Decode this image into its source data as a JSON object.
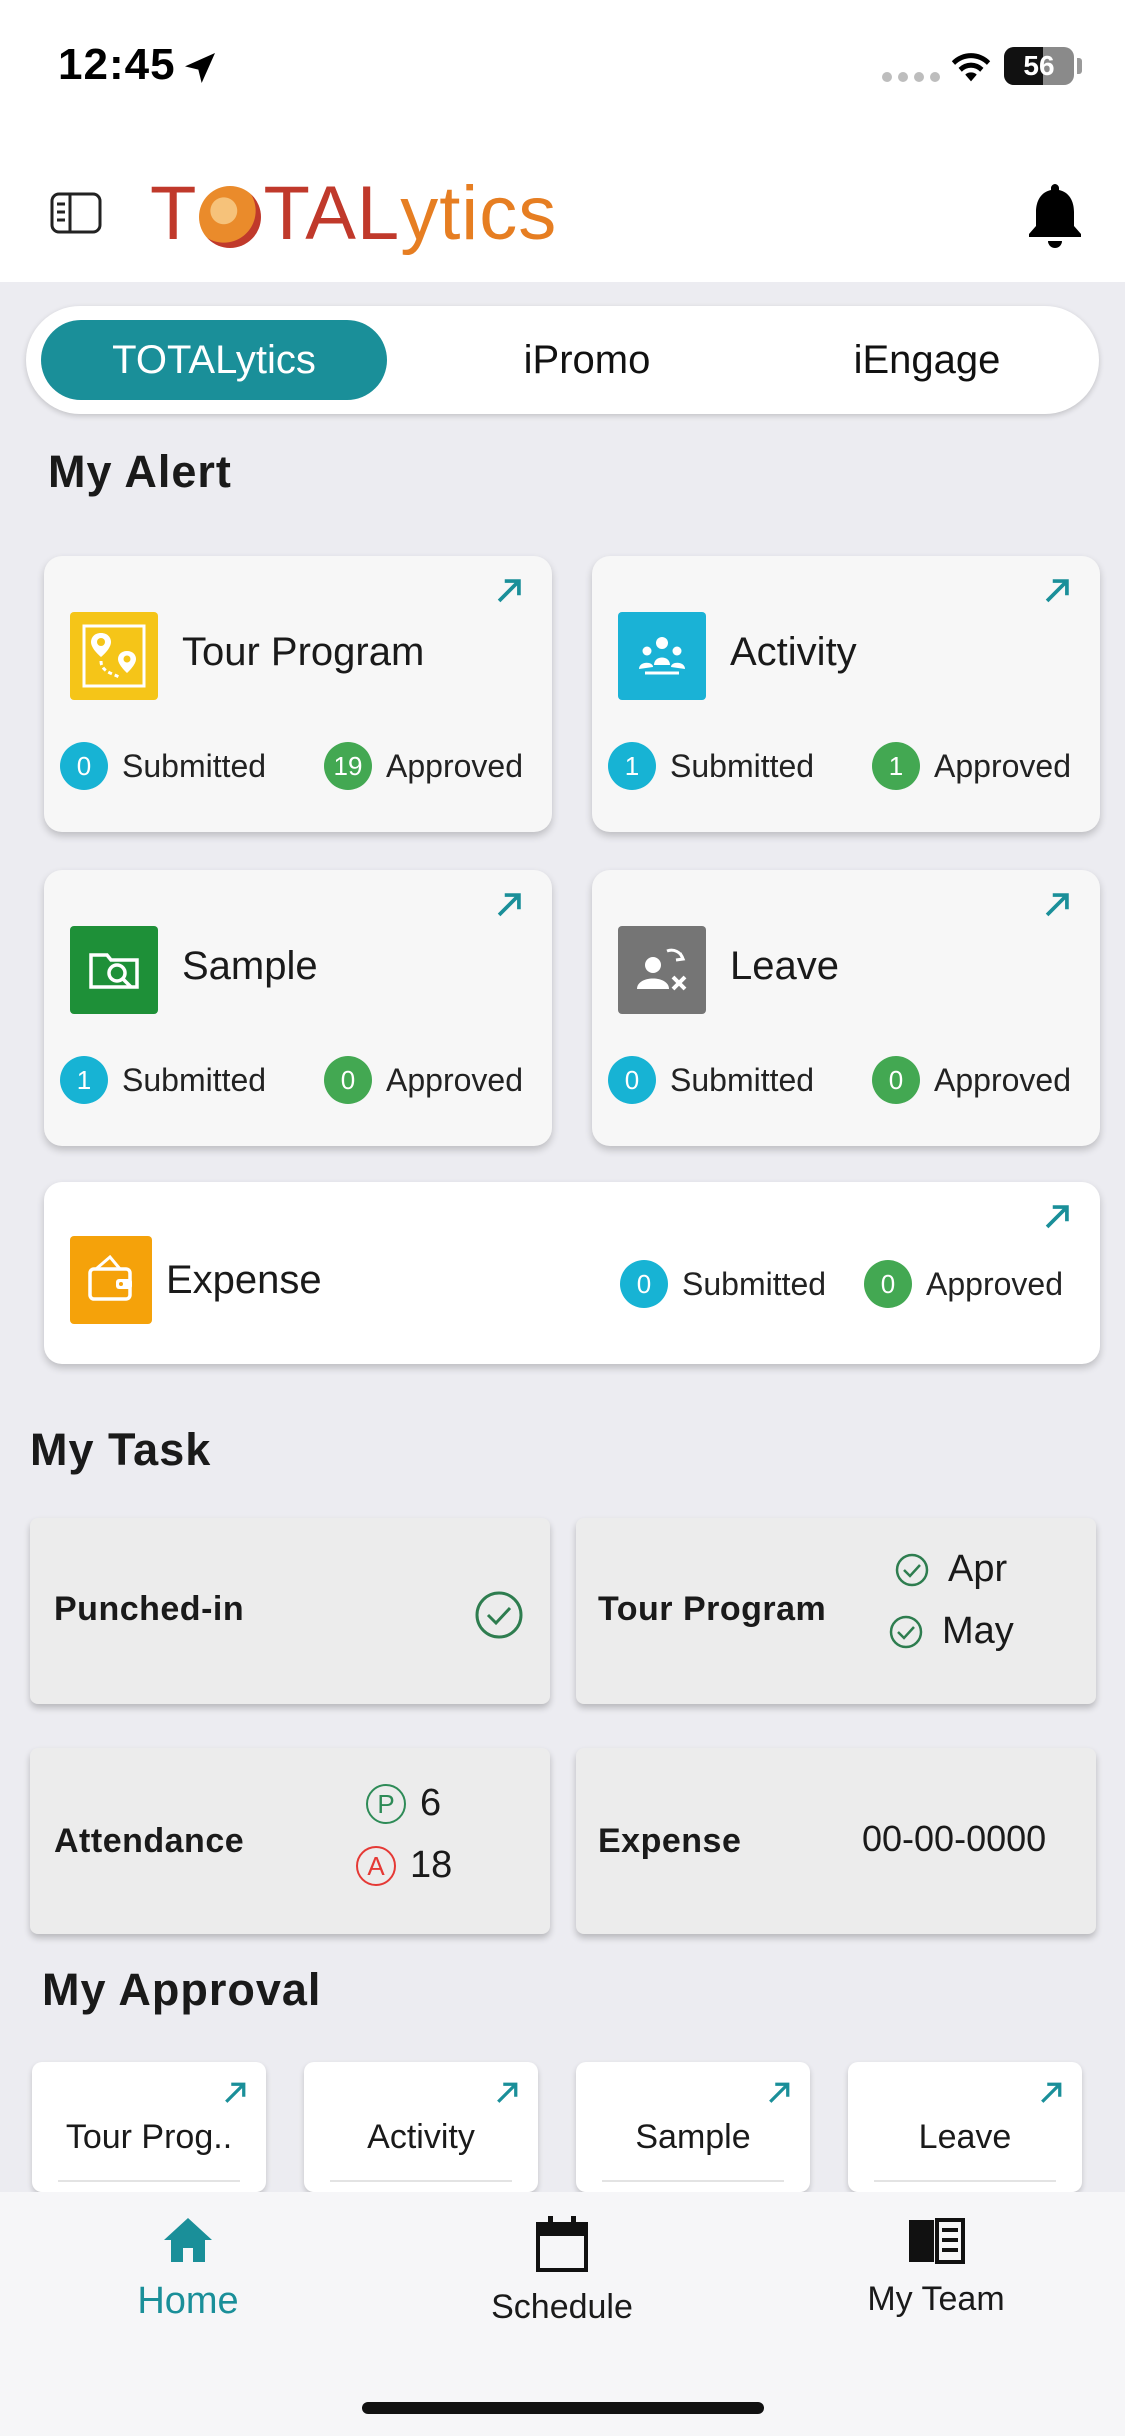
{
  "status_bar": {
    "time": "12:45",
    "battery": "56",
    "battery_level": 0.56
  },
  "header": {
    "logo_text": {
      "pre": "T",
      "post": "TAL",
      "tail": "ytics"
    },
    "menu_icon": "sidebar-icon",
    "notification_icon": "bell-icon"
  },
  "tabs": [
    {
      "label": "TOTALytics",
      "active": true
    },
    {
      "label": "iPromo",
      "active": false
    },
    {
      "label": "iEngage",
      "active": false
    }
  ],
  "alert": {
    "title": "My Alert",
    "cards": [
      {
        "name": "Tour Program",
        "icon": "map-route-icon",
        "color": "#f5c518",
        "submitted": "0",
        "submitted_label": "Submitted",
        "approved": "19",
        "approved_label": "Approved"
      },
      {
        "name": "Activity",
        "icon": "people-activity-icon",
        "color": "#1ab2d6",
        "submitted": "1",
        "submitted_label": "Submitted",
        "approved": "1",
        "approved_label": "Approved"
      },
      {
        "name": "Sample",
        "icon": "folder-search-icon",
        "color": "#1e9038",
        "submitted": "1",
        "submitted_label": "Submitted",
        "approved": "0",
        "approved_label": "Approved"
      },
      {
        "name": "Leave",
        "icon": "user-remove-icon",
        "color": "#757575",
        "submitted": "0",
        "submitted_label": "Submitted",
        "approved": "0",
        "approved_label": "Approved"
      },
      {
        "name": "Expense",
        "icon": "wallet-icon",
        "color": "#f5a20a",
        "submitted": "0",
        "submitted_label": "Submitted",
        "approved": "0",
        "approved_label": "Approved"
      }
    ]
  },
  "task": {
    "title": "My Task",
    "punched": {
      "label": "Punched-in"
    },
    "tour": {
      "label": "Tour Program",
      "months": [
        "Apr",
        "May"
      ]
    },
    "attendance": {
      "label": "Attendance",
      "p_letter": "P",
      "p_value": "6",
      "a_letter": "A",
      "a_value": "18"
    },
    "expense": {
      "label": "Expense",
      "value": "00-00-0000"
    }
  },
  "approval": {
    "title": "My Approval",
    "items": [
      "Tour Prog..",
      "Activity",
      "Sample",
      "Leave"
    ]
  },
  "bottom_nav": [
    {
      "label": "Home",
      "icon": "home-icon",
      "active": true
    },
    {
      "label": "Schedule",
      "icon": "calendar-icon",
      "active": false
    },
    {
      "label": "My Team",
      "icon": "team-icon",
      "active": false
    }
  ],
  "colors": {
    "accent": "#1a8f99",
    "badge_blue": "#17b3d4",
    "badge_green": "#43a852",
    "attendance_p": "#2e8b57",
    "attendance_a": "#e53935"
  }
}
